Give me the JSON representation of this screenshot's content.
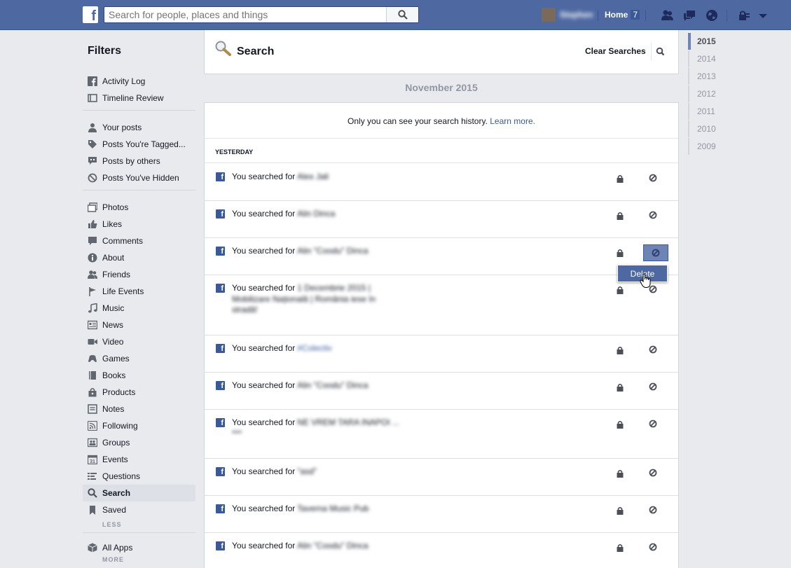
{
  "topbar": {
    "logo": "f",
    "search_placeholder": "Search for people, places and things",
    "profile_name": "Stephen",
    "home_label": "Home",
    "home_count": "7"
  },
  "filters": {
    "title": "Filters",
    "groups": [
      [
        {
          "label": "Activity Log",
          "icon": "facebook-icon"
        },
        {
          "label": "Timeline Review",
          "icon": "timeline-icon"
        }
      ],
      [
        {
          "label": "Your posts",
          "icon": "person-icon"
        },
        {
          "label": "Posts You're Tagged...",
          "icon": "tag-icon"
        },
        {
          "label": "Posts by others",
          "icon": "speech-icon"
        },
        {
          "label": "Posts You've Hidden",
          "icon": "hidden-icon"
        }
      ],
      [
        {
          "label": "Photos",
          "icon": "photos-icon"
        },
        {
          "label": "Likes",
          "icon": "like-icon"
        },
        {
          "label": "Comments",
          "icon": "comment-icon"
        },
        {
          "label": "About",
          "icon": "info-icon"
        },
        {
          "label": "Friends",
          "icon": "friends-icon"
        },
        {
          "label": "Life Events",
          "icon": "flag-icon"
        },
        {
          "label": "Music",
          "icon": "music-icon"
        },
        {
          "label": "News",
          "icon": "news-icon"
        },
        {
          "label": "Video",
          "icon": "video-icon"
        },
        {
          "label": "Games",
          "icon": "games-icon"
        },
        {
          "label": "Books",
          "icon": "book-icon"
        },
        {
          "label": "Products",
          "icon": "bag-icon"
        },
        {
          "label": "Notes",
          "icon": "notes-icon"
        },
        {
          "label": "Following",
          "icon": "rss-icon"
        },
        {
          "label": "Groups",
          "icon": "groups-icon"
        },
        {
          "label": "Events",
          "icon": "calendar-icon"
        },
        {
          "label": "Questions",
          "icon": "questions-icon"
        },
        {
          "label": "Search",
          "icon": "search-icon",
          "active": true
        },
        {
          "label": "Saved",
          "icon": "bookmark-icon"
        }
      ]
    ],
    "less_label": "LESS",
    "all_apps_label": "All Apps",
    "more_label": "MORE"
  },
  "header": {
    "title": "Search",
    "clear_label": "Clear Searches"
  },
  "month_label": "November 2015",
  "notice": {
    "text": "Only you can see your search history.",
    "link": "Learn more."
  },
  "day_label": "YESTERDAY",
  "rows": [
    {
      "prefix": "You searched for",
      "query": "Alex Jali",
      "lines": []
    },
    {
      "prefix": "You searched for",
      "query": "Alin Dinca",
      "lines": []
    },
    {
      "prefix": "You searched for",
      "query": "Alin \"Coodu\" Dinca",
      "lines": [],
      "selected": true
    },
    {
      "prefix": "You searched for",
      "query": "1 Decembrie 2015 |",
      "lines": [
        "Mobilizare Națională | România iese în",
        "stradă!"
      ]
    },
    {
      "prefix": "You searched for",
      "query": "#Colectiv",
      "lines": [],
      "link": true
    },
    {
      "prefix": "You searched for",
      "query": "Alin \"Coodu\" Dinca",
      "lines": []
    },
    {
      "prefix": "You searched for",
      "query": "NE VREM TARA INAPOI ...",
      "lines": [
        "***"
      ]
    },
    {
      "prefix": "You searched for",
      "query": "\"asd\"",
      "lines": []
    },
    {
      "prefix": "You searched for",
      "query": "Taverna Music Pub",
      "lines": []
    },
    {
      "prefix": "You searched for",
      "query": "Alin \"Coodu\" Dinca",
      "lines": []
    }
  ],
  "delete_label": "Delete",
  "years": [
    "2015",
    "2014",
    "2013",
    "2012",
    "2011",
    "2010",
    "2009"
  ],
  "colors": {
    "topbar": "#4e69a2",
    "link": "#3b5998",
    "page_bg": "#e9eaed"
  }
}
